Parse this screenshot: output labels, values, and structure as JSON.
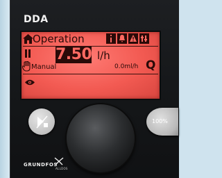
{
  "device": {
    "model_label": "DDA",
    "brand": "GRUNDFOS",
    "sub_brand": "ALLDOS"
  },
  "display": {
    "title": "Operation",
    "setpoint_value": "7.50",
    "setpoint_unit": "l/h",
    "mode_label": "Manual",
    "actual_rate": "0.0ml/h",
    "q_label": "Q",
    "backlight_color": "#f25a52"
  },
  "controls": {
    "left_button_icon": "run-stop-icon",
    "right_button_label": "100%",
    "knob_icon": "click-wheel"
  }
}
